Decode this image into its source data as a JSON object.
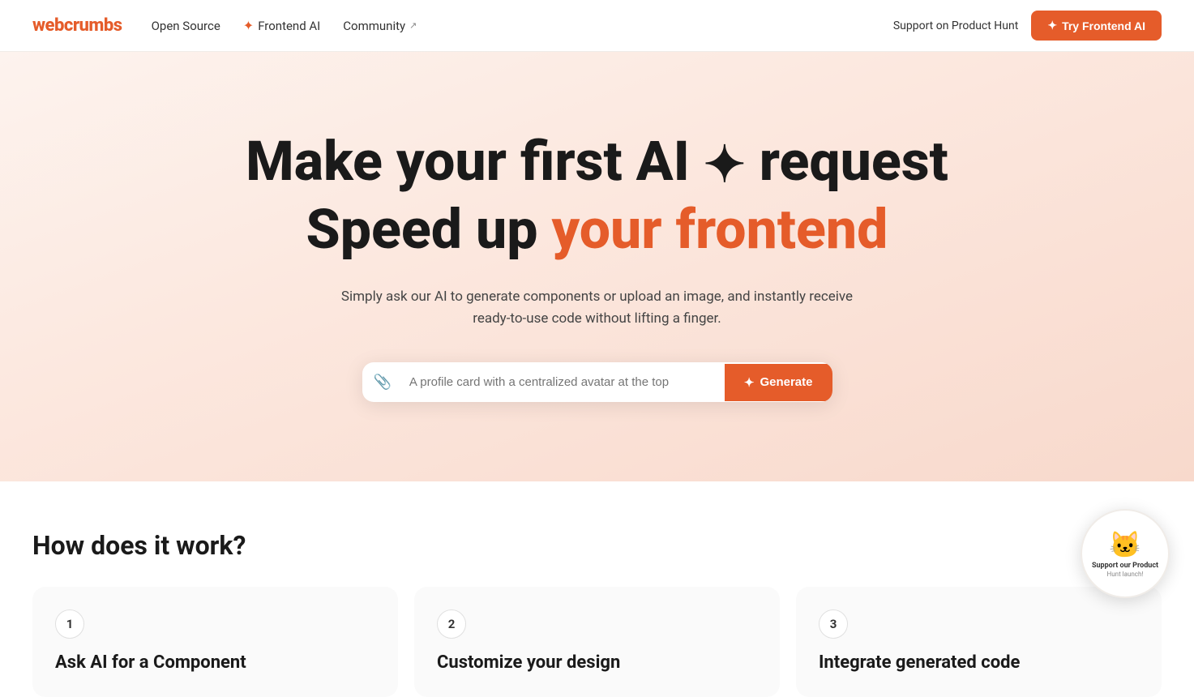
{
  "logo": {
    "text": "webcrumbs"
  },
  "nav": {
    "links": [
      {
        "id": "open-source",
        "label": "Open Source",
        "has_icon": false
      },
      {
        "id": "frontend-ai",
        "label": "Frontend AI",
        "has_icon": true,
        "icon": "✦"
      },
      {
        "id": "community",
        "label": "Community",
        "has_icon": false,
        "external": true
      }
    ],
    "support_label": "Support on Product Hunt",
    "try_label": "Try Frontend AI",
    "try_icon": "✦"
  },
  "hero": {
    "line1_part1": "Make your first AI",
    "line1_sparkle": "✦",
    "line1_part2": "request",
    "line2_part1": "Speed up",
    "line2_highlight": "your frontend",
    "description": "Simply ask our AI to generate components or upload an image, and instantly receive ready-to-use code without lifting a finger.",
    "input_placeholder": "A profile card with a centralized avatar at the top",
    "generate_label": "Generate",
    "generate_icon": "✦",
    "attach_icon": "📎"
  },
  "how": {
    "title": "How does it work?",
    "steps": [
      {
        "number": "1",
        "label": "Ask AI for a Component"
      },
      {
        "number": "2",
        "label": "Customize your design"
      },
      {
        "number": "3",
        "label": "Integrate generated code"
      }
    ]
  },
  "ph_badge": {
    "cat_emoji": "🐱",
    "line1": "Support our Product",
    "line2": "Hunt launch!"
  }
}
